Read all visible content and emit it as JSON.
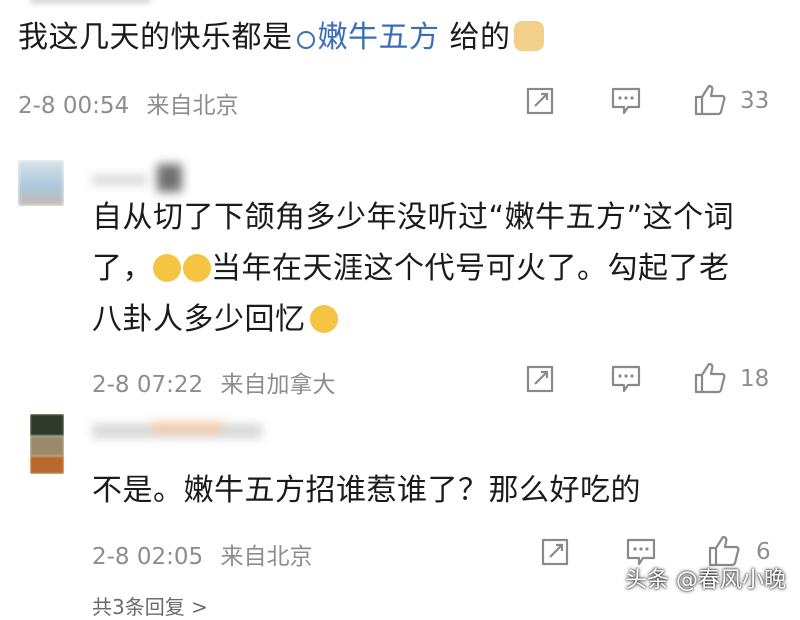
{
  "comments": [
    {
      "text_before": "我这几天的快乐都是",
      "topic": "嫩牛五方",
      "text_after": " 给的",
      "time": "2-8 00:54",
      "location": "来自北京",
      "likes": "33"
    },
    {
      "line1": "自从切了下颌角多少年没听过“嫩牛五方”这个词",
      "line2_prefix": "了，",
      "line2_rest": "当年在天涯这个代号可火了。勾起了老",
      "line3": "八卦人多少回忆",
      "time": "2-8 07:22",
      "location": "来自加拿大",
      "likes": "18"
    },
    {
      "text": "不是。嫩牛五方招谁惹谁了？那么好吃的",
      "time": "2-8 02:05",
      "location": "来自北京",
      "likes": "6"
    }
  ],
  "more_replies": "共3条回复 >",
  "watermark": "头条 @春风小晚",
  "colors": {
    "topic": "#3a6fb6",
    "meta": "#8d8d8d",
    "emoji": "#f6c443"
  }
}
